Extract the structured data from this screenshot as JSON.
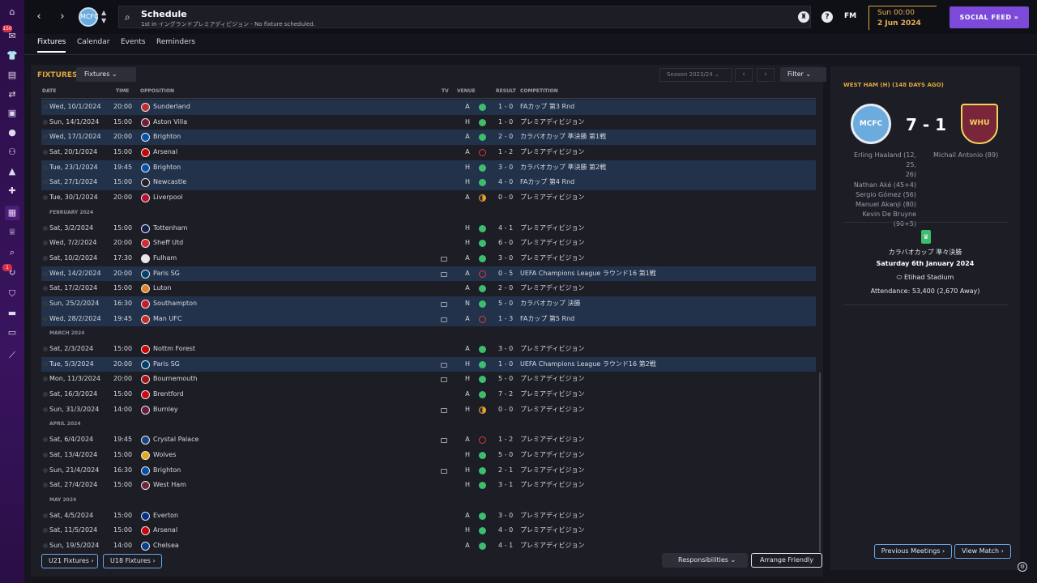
{
  "header": {
    "back_icon": "‹",
    "forward_icon": "›",
    "club_badge_text": "MCFC",
    "search_icon": "⌕",
    "title": "Schedule",
    "subtitle": "1st in イングランドプレミアディビジョン - No fixture scheduled.",
    "fm_label": "FM",
    "time": "Sun 00:00",
    "date": "2 Jun 2024",
    "social_feed": "SOCIAL FEED »"
  },
  "nav_badges": [
    "150",
    "1"
  ],
  "tabs": [
    "Fixtures",
    "Calendar",
    "Events",
    "Reminders"
  ],
  "fixtures": {
    "title": "FIXTURES",
    "view_dropdown": "Fixtures ⌄",
    "season": "Season 2023/24 ⌄",
    "prev": "‹",
    "next": "›",
    "filter": "Filter ⌄",
    "columns": {
      "date": "DATE",
      "time": "TIME",
      "opposition": "OPPOSITION",
      "tv": "TV",
      "venue": "VENUE",
      "result": "RESULT",
      "competition": "COMPETITION"
    },
    "rows": [
      {
        "date": "Wed, 10/1/2024",
        "time": "20:00",
        "opp": "Sunderland",
        "crest": "#d12b2b",
        "tv": false,
        "venue": "A",
        "res": "W",
        "score": "1 - 0",
        "comp": "FAカップ 第3 Rnd",
        "hl": true
      },
      {
        "date": "Sun, 14/1/2024",
        "time": "15:00",
        "opp": "Aston Villa",
        "crest": "#7a1f3d",
        "tv": false,
        "venue": "H",
        "res": "W",
        "score": "1 - 0",
        "comp": "プレミアディビジョン",
        "hl": false
      },
      {
        "date": "Wed, 17/1/2024",
        "time": "20:00",
        "opp": "Brighton",
        "crest": "#0057b8",
        "tv": false,
        "venue": "A",
        "res": "W",
        "score": "2 - 0",
        "comp": "カラバオカップ 準決勝 第1戦",
        "hl": true
      },
      {
        "date": "Sat, 20/1/2024",
        "time": "15:00",
        "opp": "Arsenal",
        "crest": "#db0007",
        "tv": false,
        "venue": "A",
        "res": "L",
        "score": "1 - 2",
        "comp": "プレミアディビジョン",
        "hl": false
      },
      {
        "date": "Tue, 23/1/2024",
        "time": "19:45",
        "opp": "Brighton",
        "crest": "#0057b8",
        "tv": false,
        "venue": "H",
        "res": "W",
        "score": "3 - 0",
        "comp": "カラバオカップ 準決勝 第2戦",
        "hl": true
      },
      {
        "date": "Sat, 27/1/2024",
        "time": "15:00",
        "opp": "Newcastle",
        "crest": "#241f20",
        "tv": false,
        "venue": "H",
        "res": "W",
        "score": "4 - 0",
        "comp": "FAカップ 第4 Rnd",
        "hl": true
      },
      {
        "date": "Tue, 30/1/2024",
        "time": "20:00",
        "opp": "Liverpool",
        "crest": "#c8102e",
        "tv": false,
        "venue": "A",
        "res": "D",
        "score": "0 - 0",
        "comp": "プレミアディビジョン",
        "hl": false
      },
      {
        "month": "FEBRUARY 2024"
      },
      {
        "date": "Sat, 3/2/2024",
        "time": "15:00",
        "opp": "Tottenham",
        "crest": "#132257",
        "tv": false,
        "venue": "H",
        "res": "W",
        "score": "4 - 1",
        "comp": "プレミアディビジョン",
        "hl": false
      },
      {
        "date": "Wed, 7/2/2024",
        "time": "20:00",
        "opp": "Sheff Utd",
        "crest": "#ee2737",
        "tv": false,
        "venue": "H",
        "res": "W",
        "score": "6 - 0",
        "comp": "プレミアディビジョン",
        "hl": false
      },
      {
        "date": "Sat, 10/2/2024",
        "time": "17:30",
        "opp": "Fulham",
        "crest": "#ffffff",
        "tv": true,
        "venue": "A",
        "res": "W",
        "score": "3 - 0",
        "comp": "プレミアディビジョン",
        "hl": false
      },
      {
        "date": "Wed, 14/2/2024",
        "time": "20:00",
        "opp": "Paris SG",
        "crest": "#004170",
        "tv": true,
        "venue": "A",
        "res": "L",
        "score": "0 - 5",
        "comp": "UEFA Champions League ラウンド16 第1戦",
        "hl": true
      },
      {
        "date": "Sat, 17/2/2024",
        "time": "15:00",
        "opp": "Luton",
        "crest": "#f78f1e",
        "tv": false,
        "venue": "A",
        "res": "W",
        "score": "2 - 0",
        "comp": "プレミアディビジョン",
        "hl": false
      },
      {
        "date": "Sun, 25/2/2024",
        "time": "16:30",
        "opp": "Southampton",
        "crest": "#d71920",
        "tv": true,
        "venue": "N",
        "res": "W",
        "score": "5 - 0",
        "comp": "カラバオカップ 決勝",
        "hl": true
      },
      {
        "date": "Wed, 28/2/2024",
        "time": "19:45",
        "opp": "Man UFC",
        "crest": "#da291c",
        "tv": true,
        "venue": "A",
        "res": "L",
        "score": "1 - 3",
        "comp": "FAカップ 第5 Rnd",
        "hl": true
      },
      {
        "month": "MARCH 2024"
      },
      {
        "date": "Sat, 2/3/2024",
        "time": "15:00",
        "opp": "Nottm Forest",
        "crest": "#dd0000",
        "tv": false,
        "venue": "A",
        "res": "W",
        "score": "3 - 0",
        "comp": "プレミアディビジョン",
        "hl": false
      },
      {
        "date": "Tue, 5/3/2024",
        "time": "20:00",
        "opp": "Paris SG",
        "crest": "#004170",
        "tv": true,
        "venue": "H",
        "res": "W",
        "score": "1 - 0",
        "comp": "UEFA Champions League ラウンド16 第2戦",
        "hl": true
      },
      {
        "date": "Mon, 11/3/2024",
        "time": "20:00",
        "opp": "Bournemouth",
        "crest": "#b50e12",
        "tv": true,
        "venue": "H",
        "res": "W",
        "score": "5 - 0",
        "comp": "プレミアディビジョン",
        "hl": false
      },
      {
        "date": "Sat, 16/3/2024",
        "time": "15:00",
        "opp": "Brentford",
        "crest": "#e30613",
        "tv": false,
        "venue": "A",
        "res": "W",
        "score": "7 - 2",
        "comp": "プレミアディビジョン",
        "hl": false
      },
      {
        "date": "Sun, 31/3/2024",
        "time": "14:00",
        "opp": "Burnley",
        "crest": "#6c1d45",
        "tv": true,
        "venue": "H",
        "res": "D",
        "score": "0 - 0",
        "comp": "プレミアディビジョン",
        "hl": false
      },
      {
        "month": "APRIL 2024"
      },
      {
        "date": "Sat, 6/4/2024",
        "time": "19:45",
        "opp": "Crystal Palace",
        "crest": "#1b458f",
        "tv": true,
        "venue": "A",
        "res": "L",
        "score": "1 - 2",
        "comp": "プレミアディビジョン",
        "hl": false
      },
      {
        "date": "Sat, 13/4/2024",
        "time": "15:00",
        "opp": "Wolves",
        "crest": "#fdb913",
        "tv": false,
        "venue": "H",
        "res": "W",
        "score": "5 - 0",
        "comp": "プレミアディビジョン",
        "hl": false
      },
      {
        "date": "Sun, 21/4/2024",
        "time": "16:30",
        "opp": "Brighton",
        "crest": "#0057b8",
        "tv": true,
        "venue": "H",
        "res": "W",
        "score": "2 - 1",
        "comp": "プレミアディビジョン",
        "hl": false
      },
      {
        "date": "Sat, 27/4/2024",
        "time": "15:00",
        "opp": "West Ham",
        "crest": "#7a263a",
        "tv": false,
        "venue": "H",
        "res": "W",
        "score": "3 - 1",
        "comp": "プレミアディビジョン",
        "hl": false
      },
      {
        "month": "MAY 2024"
      },
      {
        "date": "Sat, 4/5/2024",
        "time": "15:00",
        "opp": "Everton",
        "crest": "#003399",
        "tv": false,
        "venue": "A",
        "res": "W",
        "score": "3 - 0",
        "comp": "プレミアディビジョン",
        "hl": false
      },
      {
        "date": "Sat, 11/5/2024",
        "time": "15:00",
        "opp": "Arsenal",
        "crest": "#db0007",
        "tv": false,
        "venue": "H",
        "res": "W",
        "score": "4 - 0",
        "comp": "プレミアディビジョン",
        "hl": false
      },
      {
        "date": "Sun, 19/5/2024",
        "time": "14:00",
        "opp": "Chelsea",
        "crest": "#034694",
        "tv": false,
        "venue": "A",
        "res": "W",
        "score": "4 - 1",
        "comp": "プレミアディビジョン",
        "hl": false
      }
    ],
    "u21_button": "U21 Fixtures ›",
    "u18_button": "U18 Fixtures ›",
    "responsibilities": "Responsibilities ⌄",
    "arrange_friendly": "Arrange Friendly"
  },
  "match_panel": {
    "title": "WEST HAM (H) (148 DAYS AGO)",
    "home_crest_text": "MCFC",
    "away_crest_text": "WHU",
    "score": "7 - 1",
    "home_scorers": [
      "Erling Haaland (12, 25,",
      "26)",
      "Nathan Aké (45+4)",
      "Sergio Gómez (56)",
      "Manuel Akanji (80)",
      "Kevin De Bruyne (90+5)"
    ],
    "away_scorers": [
      "Michail Antonio (89)"
    ],
    "competition_icon": "♛",
    "competition": "カラバオカップ 準々決勝",
    "date": "Saturday 6th January 2024",
    "stadium": "Etihad Stadium",
    "attendance": "Attendance: 53,400 (2,670 Away)",
    "previous_meetings": "Previous Meetings ›",
    "view_match": "View Match ›"
  },
  "colors": {
    "accent_gold": "#e2a63b",
    "win": "#3dbd6d",
    "loss": "#e03a3a",
    "draw": "#e7a42b",
    "social_purple": "#7c49d8",
    "highlight_row": "#22324a"
  }
}
